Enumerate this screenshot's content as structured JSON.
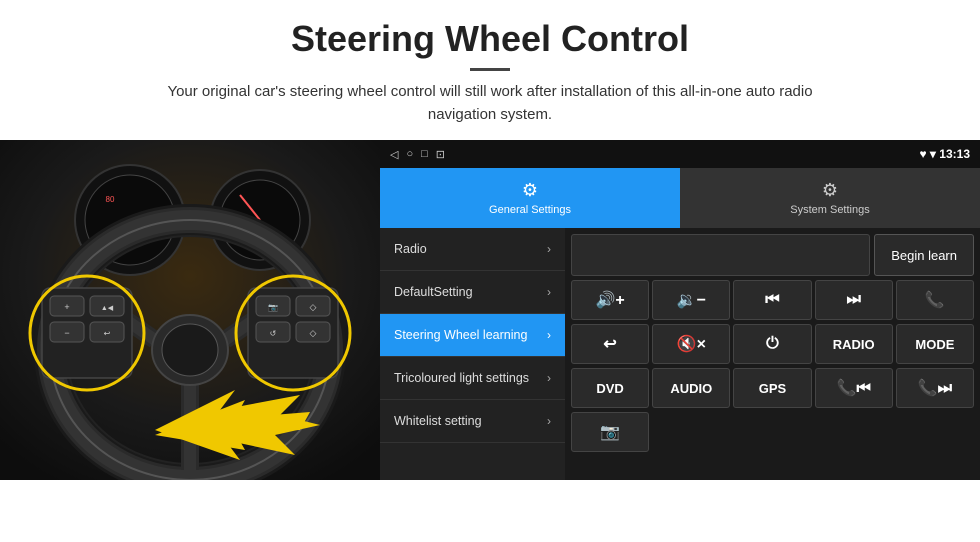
{
  "header": {
    "title": "Steering Wheel Control",
    "subtitle": "Your original car's steering wheel control will still work after installation of this all-in-one auto radio navigation system."
  },
  "status_bar": {
    "icons": [
      "◁",
      "○",
      "□",
      "⊡"
    ],
    "right_icons": "♥ ▾",
    "time": "13:13"
  },
  "tabs": [
    {
      "id": "general",
      "label": "General Settings",
      "icon": "⚙",
      "active": true
    },
    {
      "id": "system",
      "label": "System Settings",
      "icon": "⚙",
      "active": false
    }
  ],
  "menu_items": [
    {
      "id": "radio",
      "label": "Radio",
      "active": false
    },
    {
      "id": "default-setting",
      "label": "DefaultSetting",
      "active": false
    },
    {
      "id": "steering-wheel",
      "label": "Steering Wheel learning",
      "active": true
    },
    {
      "id": "tricoloured",
      "label": "Tricoloured light settings",
      "active": false
    },
    {
      "id": "whitelist",
      "label": "Whitelist setting",
      "active": false
    }
  ],
  "controls": {
    "begin_learn_label": "Begin learn",
    "row1": [
      {
        "id": "vol-up",
        "label": "🔊+",
        "type": "icon"
      },
      {
        "id": "vol-down",
        "label": "🔉−",
        "type": "icon"
      },
      {
        "id": "prev-track",
        "label": "⏮",
        "type": "icon"
      },
      {
        "id": "next-track",
        "label": "⏭",
        "type": "icon"
      },
      {
        "id": "phone",
        "label": "📞",
        "type": "icon"
      }
    ],
    "row2": [
      {
        "id": "hang-up",
        "label": "↩",
        "type": "icon"
      },
      {
        "id": "mute",
        "label": "🔇×",
        "type": "icon"
      },
      {
        "id": "power",
        "label": "⏻",
        "type": "icon"
      },
      {
        "id": "radio-btn",
        "label": "RADIO",
        "type": "text"
      },
      {
        "id": "mode-btn",
        "label": "MODE",
        "type": "text"
      }
    ],
    "row3": [
      {
        "id": "dvd",
        "label": "DVD",
        "type": "text"
      },
      {
        "id": "audio",
        "label": "AUDIO",
        "type": "text"
      },
      {
        "id": "gps",
        "label": "GPS",
        "type": "text"
      }
    ],
    "row4": [
      {
        "id": "phone-vol-up",
        "label": "📞⏮",
        "type": "icon"
      },
      {
        "id": "phone-vol-down",
        "label": "📞⏭",
        "type": "icon"
      }
    ],
    "row5": [
      {
        "id": "camera",
        "label": "📷",
        "type": "icon"
      }
    ]
  }
}
